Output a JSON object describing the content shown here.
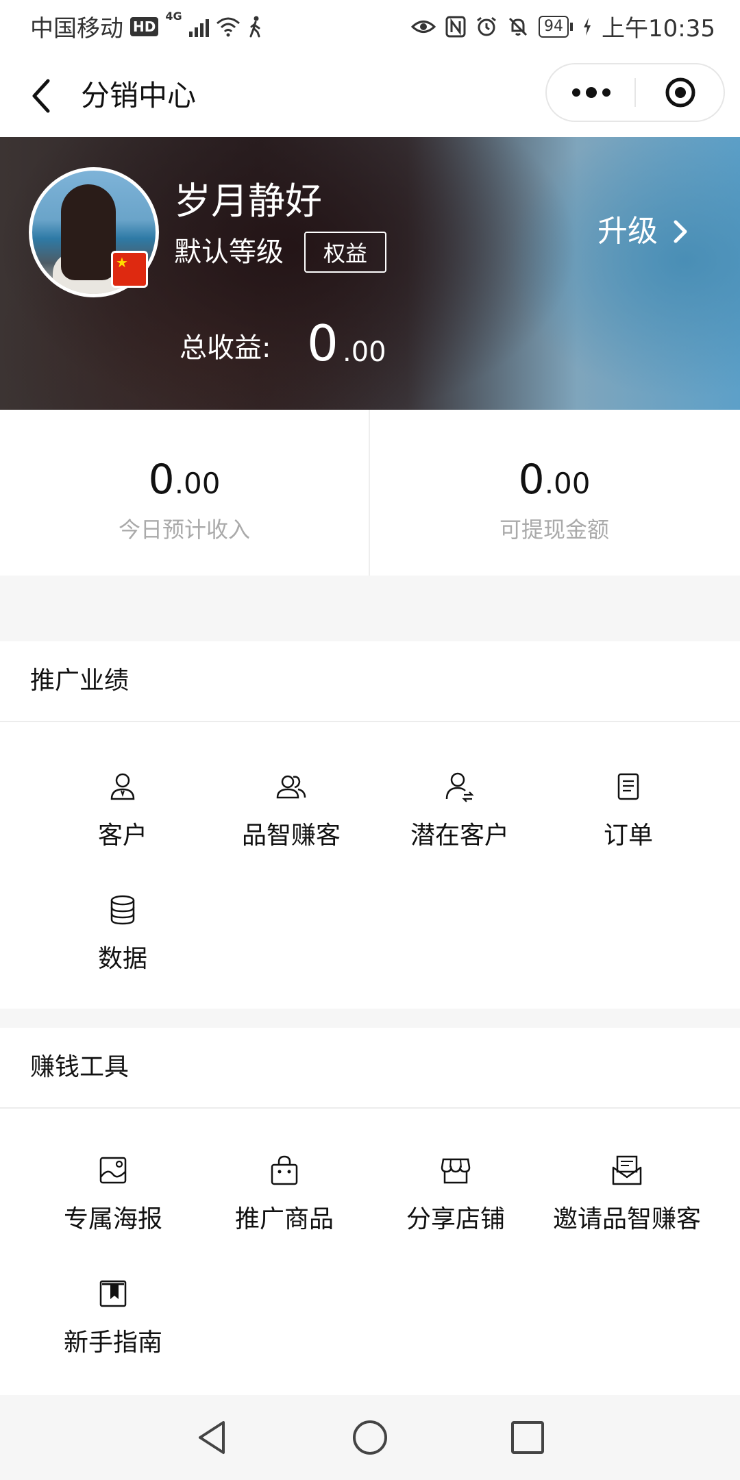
{
  "status_bar": {
    "carrier": "中国移动",
    "hd": "HD",
    "network": "4G",
    "battery": "94",
    "time": "上午10:35"
  },
  "nav": {
    "title": "分销中心"
  },
  "profile": {
    "name": "岁月静好",
    "level": "默认等级",
    "rights_button": "权益",
    "upgrade_label": "升级",
    "total_label": "总收益:",
    "total_int": "0",
    "total_dec": ".00"
  },
  "stats": [
    {
      "int": "0",
      "dec": ".00",
      "label": "今日预计收入"
    },
    {
      "int": "0",
      "dec": ".00",
      "label": "可提现金额"
    }
  ],
  "sections": {
    "performance": {
      "title": "推广业绩",
      "items": [
        {
          "label": "客户",
          "icon": "customer-icon"
        },
        {
          "label": "品智赚客",
          "icon": "users-icon"
        },
        {
          "label": "潜在客户",
          "icon": "potential-customer-icon"
        },
        {
          "label": "订单",
          "icon": "order-icon"
        },
        {
          "label": "数据",
          "icon": "database-icon"
        }
      ]
    },
    "tools": {
      "title": "赚钱工具",
      "items": [
        {
          "label": "专属海报",
          "icon": "poster-icon"
        },
        {
          "label": "推广商品",
          "icon": "shopping-bag-icon"
        },
        {
          "label": "分享店铺",
          "icon": "store-icon"
        },
        {
          "label": "邀请品智赚客",
          "icon": "invite-mail-icon"
        },
        {
          "label": "新手指南",
          "icon": "guide-book-icon"
        }
      ]
    }
  }
}
